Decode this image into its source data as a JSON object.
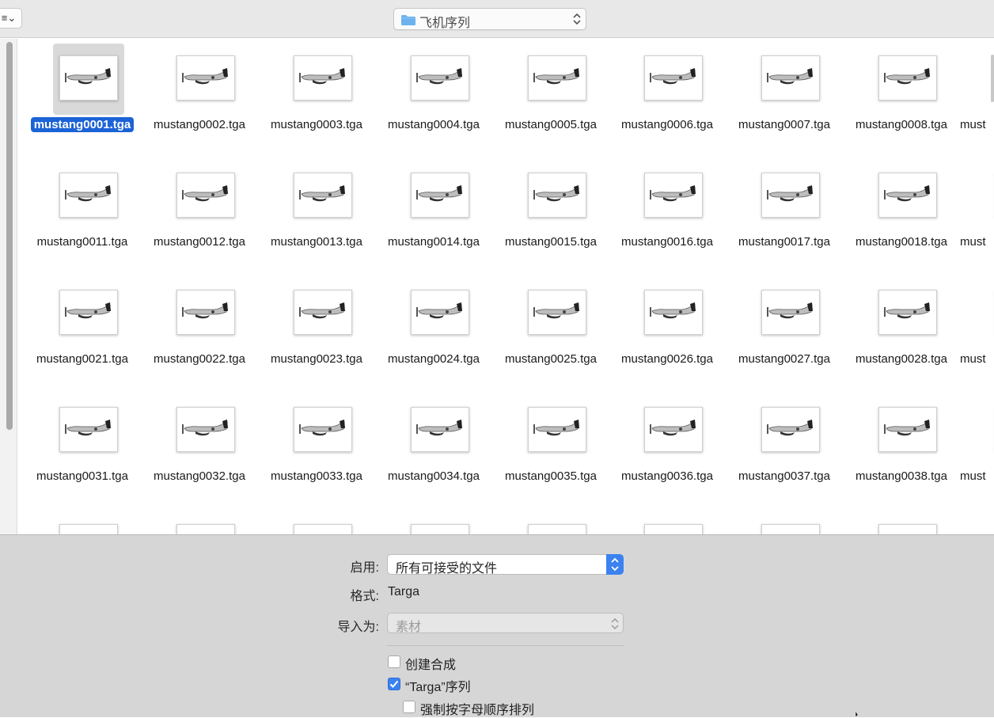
{
  "toolbar": {
    "view_button_label": "≡⌄",
    "path_label": "飞机序列"
  },
  "files": [
    "mustang0001.tga",
    "mustang0002.tga",
    "mustang0003.tga",
    "mustang0004.tga",
    "mustang0005.tga",
    "mustang0006.tga",
    "mustang0007.tga",
    "mustang0008.tga",
    "must",
    "mustang0011.tga",
    "mustang0012.tga",
    "mustang0013.tga",
    "mustang0014.tga",
    "mustang0015.tga",
    "mustang0016.tga",
    "mustang0017.tga",
    "mustang0018.tga",
    "must",
    "mustang0021.tga",
    "mustang0022.tga",
    "mustang0023.tga",
    "mustang0024.tga",
    "mustang0025.tga",
    "mustang0026.tga",
    "mustang0027.tga",
    "mustang0028.tga",
    "must",
    "mustang0031.tga",
    "mustang0032.tga",
    "mustang0033.tga",
    "mustang0034.tga",
    "mustang0035.tga",
    "mustang0036.tga",
    "mustang0037.tga",
    "mustang0038.tga",
    "must"
  ],
  "selected_file": "mustang0001.tga",
  "options": {
    "enable_label": "启用:",
    "enable_value": "所有可接受的文件",
    "format_label": "格式:",
    "format_value": "Targa",
    "import_as_label": "导入为:",
    "import_as_value": "素材",
    "create_comp_label": "创建合成",
    "create_comp_checked": false,
    "sequence_label": "“Targa”序列",
    "sequence_checked": true,
    "force_alpha_label": "强制按字母顺序排列",
    "force_alpha_checked": false
  },
  "colors": {
    "accent": "#3b82f0",
    "selection": "#1b63d6",
    "panel_bg": "#d6d6d6"
  }
}
